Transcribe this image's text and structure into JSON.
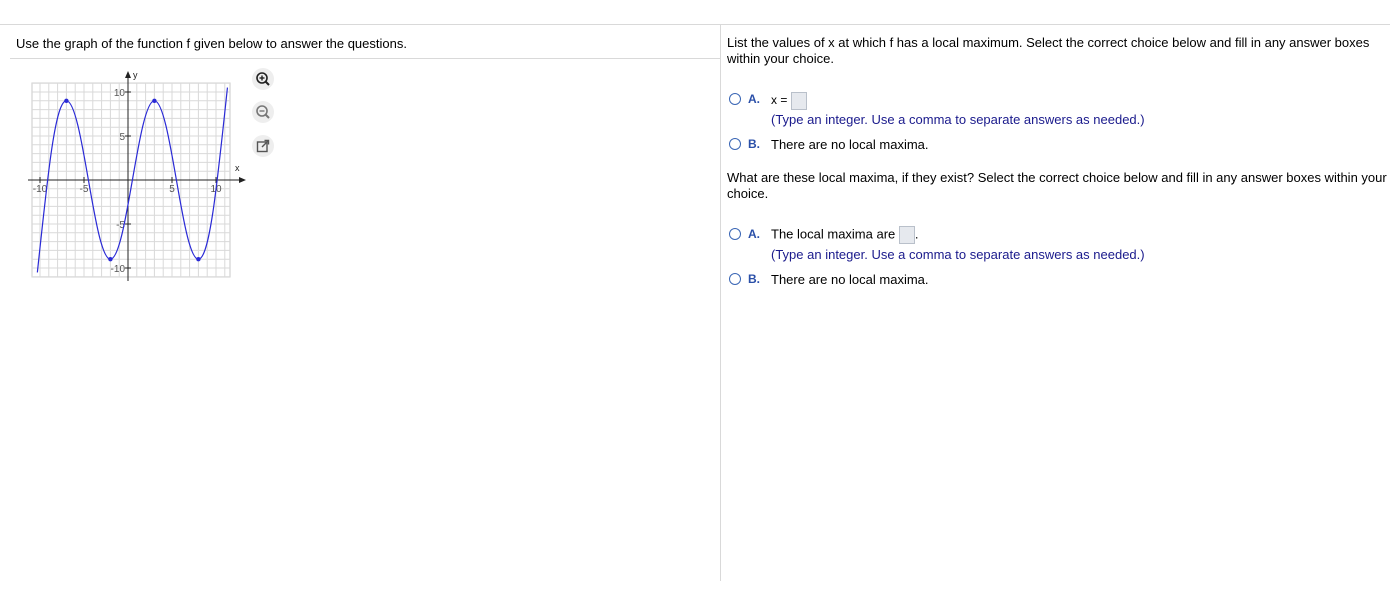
{
  "left": {
    "instruction": "Use the graph of the function f given below to answer the questions."
  },
  "graph": {
    "y_axis_label": "y",
    "x_axis_label": "x",
    "x_ticks": [
      "-10",
      "-5",
      "5",
      "10"
    ],
    "y_ticks": [
      "10",
      "5",
      "-5",
      "-10"
    ],
    "x_range": [
      -11,
      11
    ],
    "y_range": [
      -11,
      11
    ],
    "curve_color": "#2a2ad6",
    "curve_points": [
      [
        -10.3,
        -10.5
      ],
      [
        -7,
        9
      ],
      [
        -2,
        -9
      ],
      [
        3,
        9
      ],
      [
        8,
        -9
      ],
      [
        11.3,
        10.5
      ]
    ]
  },
  "tools": [
    "zoom-in-icon",
    "zoom-out-icon",
    "popout-icon"
  ],
  "q1": {
    "text": "List the values of x at which f has a local maximum. Select the correct choice below and fill in any answer boxes within your choice.",
    "optA_letter": "A.",
    "optA_label": "x =",
    "optA_hint": "(Type an integer. Use a comma to separate answers as needed.)",
    "optB_letter": "B.",
    "optB_text": "There are no local maxima."
  },
  "q2": {
    "text": "What are these local maxima, if they exist? Select the correct choice below and fill in any answer boxes within your choice.",
    "optA_letter": "A.",
    "optA_label": "The local maxima are",
    "optA_after": ".",
    "optA_hint": "(Type an integer. Use a comma to separate answers as needed.)",
    "optB_letter": "B.",
    "optB_text": "There are no local maxima."
  }
}
